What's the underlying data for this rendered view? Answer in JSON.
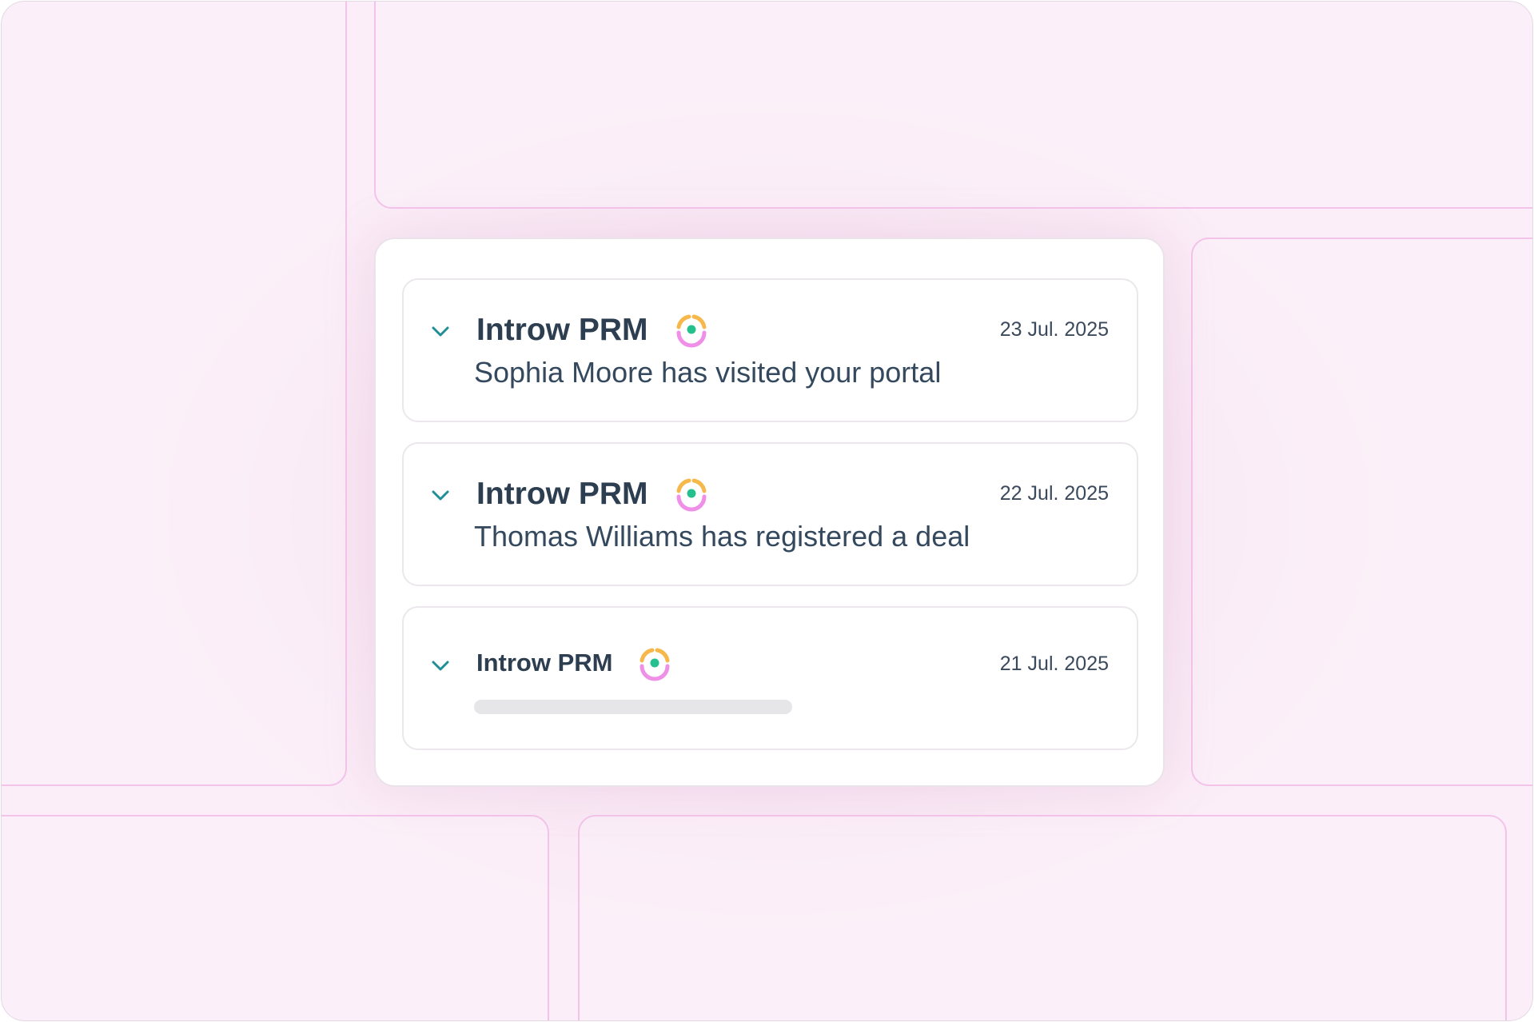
{
  "colors": {
    "background": "#fbeef8",
    "panel_border": "#f3c3ea",
    "chevron": "#1f8f95",
    "title_text": "#2c3e50",
    "logo_orange": "#f7b84b",
    "logo_pink": "#ef8fe8",
    "logo_green": "#25c08e"
  },
  "notifications": [
    {
      "sender": "Introw PRM",
      "date": "23 Jul. 2025",
      "message": "Sophia Moore has visited your portal",
      "expand_icon": "chevron-down-icon",
      "logo_icon": "introw-logo-icon"
    },
    {
      "sender": "Introw PRM",
      "date": "22 Jul. 2025",
      "message": "Thomas Williams has registered a deal",
      "expand_icon": "chevron-down-icon",
      "logo_icon": "introw-logo-icon"
    },
    {
      "sender": "Introw PRM",
      "date": "21 Jul. 2025",
      "message": "",
      "expand_icon": "chevron-down-icon",
      "logo_icon": "introw-logo-icon"
    }
  ]
}
